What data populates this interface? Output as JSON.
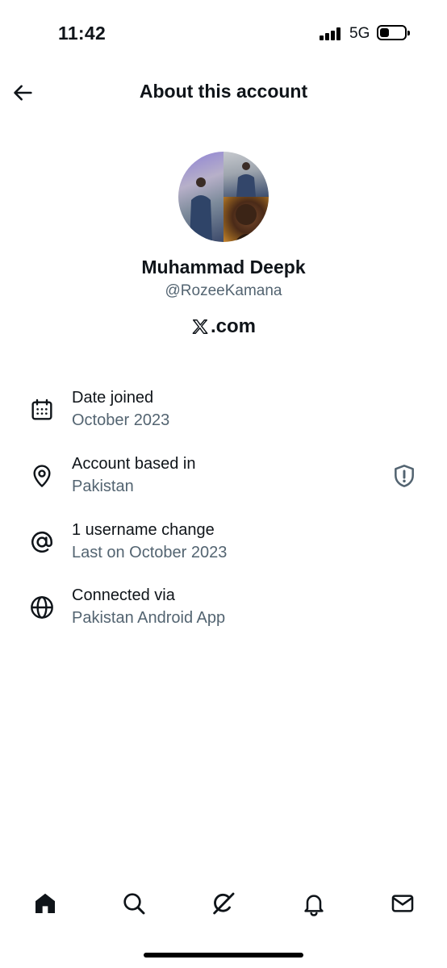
{
  "status_bar": {
    "time": "11:42",
    "network": "5G",
    "icons": [
      "signal-bars-icon",
      "battery-icon"
    ]
  },
  "header": {
    "title": "About this account",
    "back_icon": "back-arrow-icon"
  },
  "profile": {
    "display_name": "Muhammad Deepk",
    "handle": "@RozeeKamana",
    "domain_suffix": ".com",
    "domain_logo": "x-logo-icon"
  },
  "info": {
    "items": [
      {
        "icon": "calendar-icon",
        "label": "Date joined",
        "value": "October 2023"
      },
      {
        "icon": "location-pin-icon",
        "label": "Account based in",
        "value": "Pakistan",
        "trailing_icon": "shield-alert-icon"
      },
      {
        "icon": "at-sign-icon",
        "label": "1 username change",
        "value": "Last on October 2023"
      },
      {
        "icon": "globe-icon",
        "label": "Connected via",
        "value": "Pakistan Android App"
      }
    ]
  },
  "bottom_nav": {
    "items": [
      "home-icon",
      "search-icon",
      "grok-icon",
      "notifications-bell-icon",
      "messages-envelope-icon"
    ],
    "active": "home-icon"
  },
  "colors": {
    "primary_text": "#0f1419",
    "secondary_text": "#536471",
    "background": "#ffffff"
  }
}
